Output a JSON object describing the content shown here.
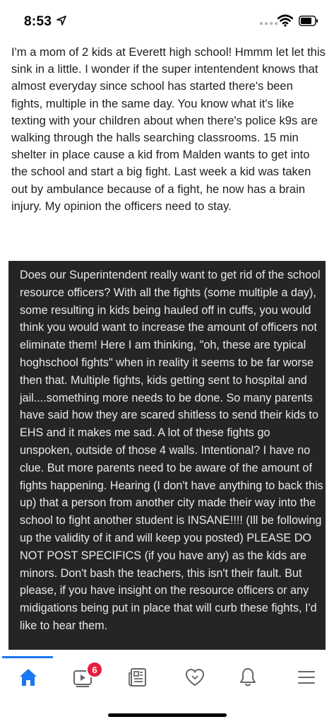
{
  "status_bar": {
    "time": "8:53"
  },
  "post_1": {
    "text": "I'm a mom of 2 kids at Everett high school! Hmmm let let this sink in a little. I wonder if the super intentendent knows that almost everyday since school has started there's been fights, multiple in the same day. You know what it's like texting with your children about when there's police k9s are walking through the halls searching classrooms. 15 min shelter in place cause a kid from Malden wants to get into the school and start a big fight. Last week a kid was taken out by ambulance because of a fight, he now has a brain injury. My opinion the officers need to stay."
  },
  "post_2": {
    "text": "Does our Superintendent really want to get rid of the school resource officers? With all the fights (some multiple a day), some resulting in kids being hauled off in cuffs, you would think you would want to increase the amount of officers not eliminate them! Here I am thinking, \"oh, these are typical hoghschool fights\" when in reality it seems to be far worse then that. Multiple fights, kids getting sent to hospital and jail....something more needs to be done. So many parents have said how they are scared shitless to send their kids to EHS and it makes me sad. A lot of these fights go unspoken, outside of those 4 walls. Intentional? I have no clue. But more parents need to be aware of the amount of fights happening. Hearing (I don't have anything to back this up) that a person from another city made their way into the school to fight another student is INSANE!!!! (Ill be following up the validity of it and will keep you posted) PLEASE DO NOT POST SPECIFICS (if you have any) as the kids are minors. Don't bash the teachers, this isn't their fault. But please, if you have insight on the resource officers or any midigations being put in place that will curb these fights, I'd like to hear them."
  },
  "tab_bar": {
    "tabs": [
      {
        "icon": "home-icon",
        "active": true
      },
      {
        "icon": "video-icon",
        "badge": "6"
      },
      {
        "icon": "news-icon"
      },
      {
        "icon": "heart-icon"
      },
      {
        "icon": "bell-icon"
      },
      {
        "icon": "menu-icon"
      }
    ],
    "accent_color": "#1877f2",
    "badge_color": "#e41e3f"
  }
}
